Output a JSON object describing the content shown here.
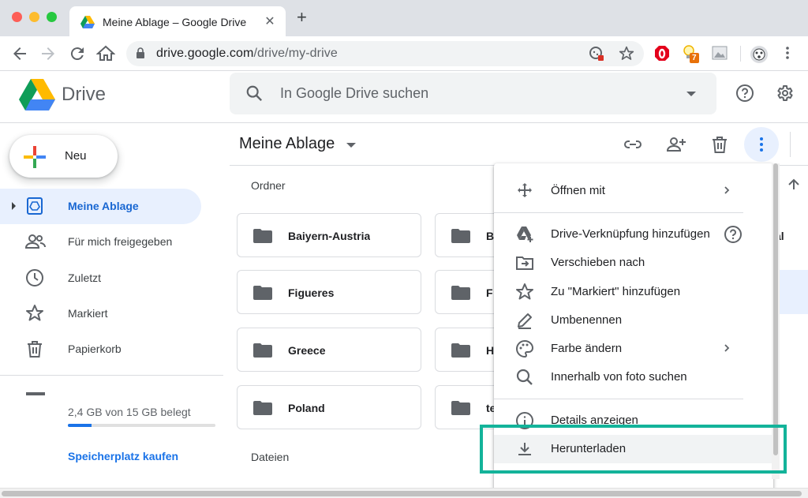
{
  "browser": {
    "tab_title": "Meine Ablage – Google Drive",
    "url_host": "drive.google.com",
    "url_path": "/drive/my-drive",
    "extension_badge": "7"
  },
  "header": {
    "app_name": "Drive",
    "search_placeholder": "In Google Drive suchen"
  },
  "sidebar": {
    "new_label": "Neu",
    "items": [
      {
        "label": "Meine Ablage",
        "icon": "my-drive-icon",
        "active": true
      },
      {
        "label": "Für mich freigegeben",
        "icon": "people-icon"
      },
      {
        "label": "Zuletzt",
        "icon": "clock-icon"
      },
      {
        "label": "Markiert",
        "icon": "star-icon"
      },
      {
        "label": "Papierkorb",
        "icon": "trash-icon"
      }
    ],
    "storage_text": "2,4 GB von 15 GB belegt",
    "storage_used_fraction": 0.16,
    "buy_link": "Speicherplatz kaufen"
  },
  "main": {
    "title": "Meine Ablage",
    "folders_label": "Ordner",
    "files_label": "Dateien",
    "folders_col1": [
      "Baiyern-Austria",
      "Figueres",
      "Greece",
      "Poland"
    ],
    "folders_col2": [
      "B",
      "F",
      "H",
      "te"
    ],
    "folders_col3_partial": "al"
  },
  "context_menu": {
    "items": [
      {
        "label": "Öffnen mit",
        "icon": "open-with-icon",
        "submenu": true
      },
      {
        "label": "Drive-Verknüpfung hinzufügen",
        "icon": "add-shortcut-icon",
        "help": true
      },
      {
        "label": "Verschieben nach",
        "icon": "move-to-icon"
      },
      {
        "label": "Zu \"Markiert\" hinzufügen",
        "icon": "star-outline-icon"
      },
      {
        "label": "Umbenennen",
        "icon": "pencil-icon"
      },
      {
        "label": "Farbe ändern",
        "icon": "palette-icon",
        "submenu": true
      },
      {
        "label": "Innerhalb von foto suchen",
        "icon": "search-icon"
      },
      {
        "label": "Details anzeigen",
        "icon": "info-icon"
      },
      {
        "label": "Herunterladen",
        "icon": "download-icon",
        "highlighted": true
      }
    ]
  },
  "colors": {
    "accent": "#1a73e8",
    "active_bg": "#e8f0fe",
    "highlight_box": "#13b39a"
  }
}
